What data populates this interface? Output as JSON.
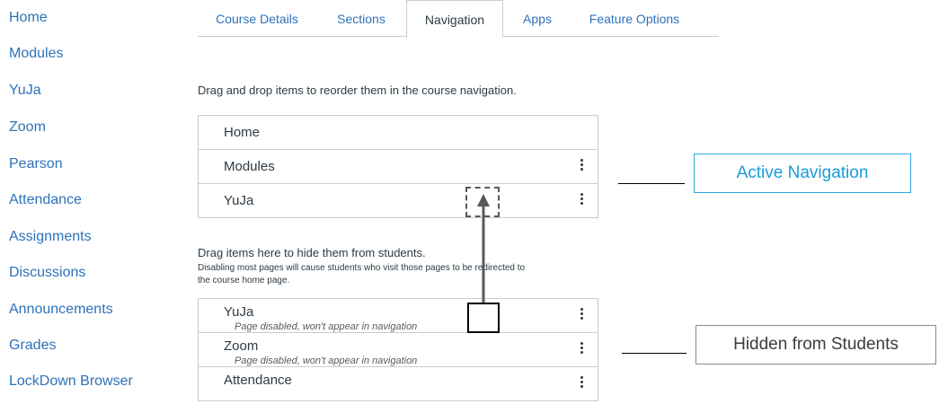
{
  "left_nav": {
    "items": [
      {
        "label": "Home"
      },
      {
        "label": "Modules"
      },
      {
        "label": "YuJa"
      },
      {
        "label": "Zoom"
      },
      {
        "label": "Pearson"
      },
      {
        "label": "Attendance"
      },
      {
        "label": "Assignments"
      },
      {
        "label": "Discussions"
      },
      {
        "label": "Announcements"
      },
      {
        "label": "Grades"
      },
      {
        "label": "LockDown Browser"
      }
    ]
  },
  "tabs": [
    {
      "label": "Course Details"
    },
    {
      "label": "Sections"
    },
    {
      "label": "Navigation",
      "active": true
    },
    {
      "label": "Apps"
    },
    {
      "label": "Feature Options"
    }
  ],
  "instructions": {
    "reorder": "Drag and drop items to reorder them in the course navigation.",
    "hide_title": "Drag items here to hide them from students.",
    "hide_note_line1": "Disabling most pages will cause students who visit those pages to be redirected to",
    "hide_note_line2": "the course home page."
  },
  "active_list": [
    {
      "label": "Home",
      "has_menu": false
    },
    {
      "label": "Modules",
      "has_menu": true
    },
    {
      "label": "YuJa",
      "has_menu": true
    }
  ],
  "hidden_list": [
    {
      "label": "YuJa",
      "sub": "Page disabled, won't appear in navigation",
      "has_menu": true
    },
    {
      "label": "Zoom",
      "sub": "Page disabled, won't appear in navigation",
      "has_menu": true
    },
    {
      "label": "Attendance",
      "sub": "",
      "has_menu": true
    }
  ],
  "callouts": {
    "active": "Active Navigation",
    "hidden": "Hidden from Students"
  },
  "colors": {
    "link": "#2d72b8",
    "text": "#2d3b45",
    "border": "#c7cdd1",
    "active_callout": "#1a9bd7"
  },
  "icons": {
    "row_menu": "kebab-menu-icon",
    "drag_arrow": "arrow-up-icon"
  }
}
